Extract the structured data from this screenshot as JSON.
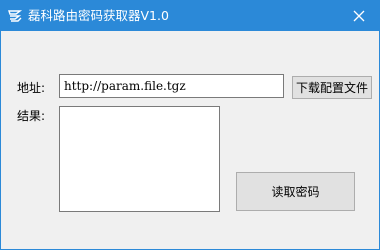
{
  "window": {
    "title": "磊科路由密码获取器V1.0",
    "app_icon": "app-logo-icon",
    "close_icon": "close-icon",
    "titlebar_color": "#2b89d8"
  },
  "form": {
    "address_label": "地址:",
    "address_value": "http://param.file.tgz",
    "download_button": "下载配置文件",
    "result_label": "结果:",
    "result_value": "",
    "read_button": "读取密码"
  }
}
